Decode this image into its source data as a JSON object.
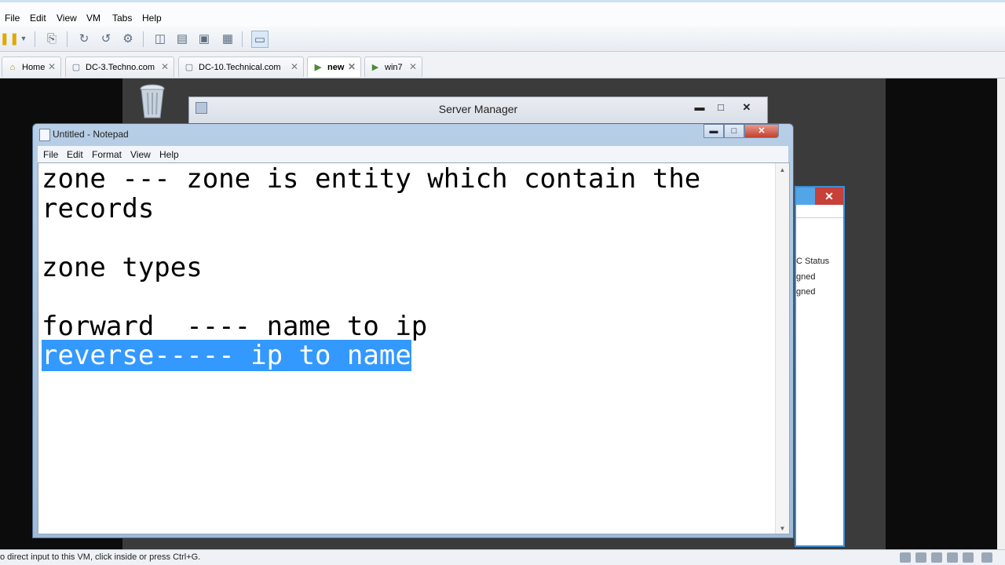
{
  "host": {
    "menu": [
      "File",
      "Edit",
      "View",
      "VM",
      "Tabs",
      "Help"
    ],
    "toolbar_icons": [
      "pause-icon",
      "dropdown-icon",
      "send-ctrl-alt-del-icon",
      "snapshot-icon",
      "revert-snapshot-icon",
      "snapshot-manager-icon",
      "sidebar-icon",
      "console-view-icon",
      "full-screen-icon",
      "unity-icon",
      "thumbnail-icon"
    ],
    "tabs": [
      {
        "label": "Home",
        "icon": "home-icon",
        "active": false
      },
      {
        "label": "DC-3.Techno.com",
        "icon": "vm-icon",
        "active": false
      },
      {
        "label": "DC-10.Technical.com",
        "icon": "vm-icon",
        "active": false
      },
      {
        "label": "new",
        "icon": "vm-running-icon",
        "active": true
      },
      {
        "label": "win7",
        "icon": "vm-running-icon",
        "active": false
      }
    ],
    "status": "o direct input to this VM, click inside or press Ctrl+G."
  },
  "server_manager": {
    "title": "Server Manager",
    "dialog_lines": [
      "C Status",
      "gned",
      "gned"
    ]
  },
  "notepad": {
    "title": "Untitled - Notepad",
    "menu": [
      "File",
      "Edit",
      "Format",
      "View",
      "Help"
    ],
    "lines": [
      "zone --- zone is entity which contain the",
      "records",
      "",
      "zone types",
      "",
      "forward  ---- name to ip"
    ],
    "selected_line": "reverse----- ip to name"
  },
  "colors": {
    "selection": "#3399ff",
    "close_red": "#c7403a"
  }
}
